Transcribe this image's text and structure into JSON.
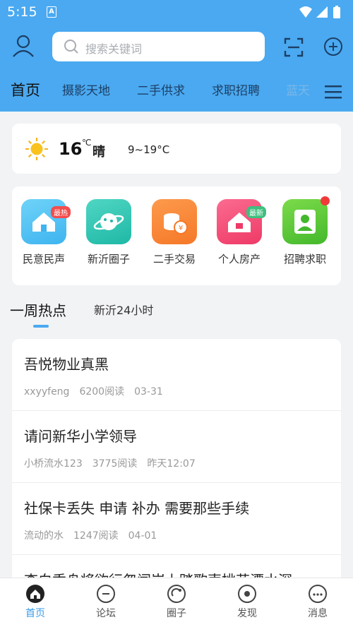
{
  "status_bar": {
    "time": "5:15",
    "notification_icon": "a-icon",
    "icons": [
      "wifi-icon",
      "signal-icon",
      "battery-icon"
    ]
  },
  "header": {
    "search_placeholder": "搜索关键词",
    "icons": [
      "user-icon",
      "scan-icon",
      "plus-icon"
    ]
  },
  "tabs": [
    "首页",
    "摄影天地",
    "二手供求",
    "求职招聘",
    "蓝天"
  ],
  "weather": {
    "temp": "16",
    "unit": "℃",
    "condition": "晴",
    "range": "9~19°C"
  },
  "apps": [
    {
      "label": "民意民声",
      "icon": "house-icon",
      "badge": "最热",
      "color": "#4fc4f4"
    },
    {
      "label": "新沂圈子",
      "icon": "planet-icon",
      "badge": "",
      "color": "#31c6b4"
    },
    {
      "label": "二手交易",
      "icon": "coins-icon",
      "badge": "",
      "color": "#fb8a3c"
    },
    {
      "label": "个人房产",
      "icon": "home-icon",
      "badge": "最新",
      "color": "#f4517c"
    },
    {
      "label": "招聘求职",
      "icon": "person-icon",
      "badge": "",
      "color": "#60cb3c"
    }
  ],
  "section_tabs": [
    "一周热点",
    "新沂24小时"
  ],
  "posts": [
    {
      "title": "吾悦物业真黑",
      "author": "xxyyfeng",
      "views": "6200阅读",
      "date": "03-31"
    },
    {
      "title": "请问新华小学领导",
      "author": "小桥流水123",
      "views": "3775阅读",
      "date": "昨天12:07"
    },
    {
      "title": "社保卡丢失 申请 补办 需要那些手续",
      "author": "流动的水",
      "views": "1247阅读",
      "date": "04-01"
    },
    {
      "title": "李白乘舟将欲行忽闻岸上踏歌声桃花潭水深",
      "author": "",
      "views": "",
      "date": ""
    }
  ],
  "bottom_nav": [
    {
      "label": "首页",
      "icon": "home-icon"
    },
    {
      "label": "论坛",
      "icon": "forum-icon"
    },
    {
      "label": "圈子",
      "icon": "circle-icon"
    },
    {
      "label": "发现",
      "icon": "discover-icon"
    },
    {
      "label": "消息",
      "icon": "message-icon"
    }
  ],
  "colors": {
    "accent": "#4aa9f0",
    "nav_active": "#3a9be8",
    "badge_red": "#f03a3a"
  }
}
